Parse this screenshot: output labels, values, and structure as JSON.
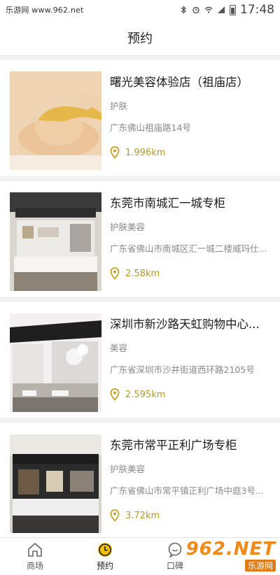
{
  "status_bar": {
    "site_label": "乐游网 www.962.net",
    "time": "17:48"
  },
  "header": {
    "title": "预约"
  },
  "stores": [
    {
      "name": "曙光美容体验店（祖庙店）",
      "category": "护肤",
      "address": "广东佛山祖庙路14号",
      "distance": "1.996km",
      "image": "facial-massage-photo"
    },
    {
      "name": "东莞市南城汇一城专柜",
      "category": "护肤美容",
      "address": "广东省佛山市南城区汇一城二楼威玛仕...",
      "distance": "2.58km",
      "image": "store-counter-photo"
    },
    {
      "name": "深圳市新沙路天虹购物中心...",
      "category": "美容",
      "address": "广东省深圳市沙井街道西环路2105号",
      "distance": "2.595km",
      "image": "weimasde-store-photo"
    },
    {
      "name": "东莞市常平正利广场专柜",
      "category": "护肤美容",
      "address": "广东省佛山市常平镇正利广场中庭3号...",
      "distance": "3.72km",
      "image": "weimasde-counter-photo"
    }
  ],
  "tabs": [
    {
      "label": "商场",
      "icon": "home-icon",
      "active": false
    },
    {
      "label": "预约",
      "icon": "clock-icon",
      "active": true
    },
    {
      "label": "口碑",
      "icon": "chat-icon",
      "active": false
    }
  ],
  "watermark": {
    "logo": "962.NET",
    "sub": "乐游网"
  },
  "colors": {
    "accent": "#f2c200",
    "distance": "#b89a1e"
  }
}
